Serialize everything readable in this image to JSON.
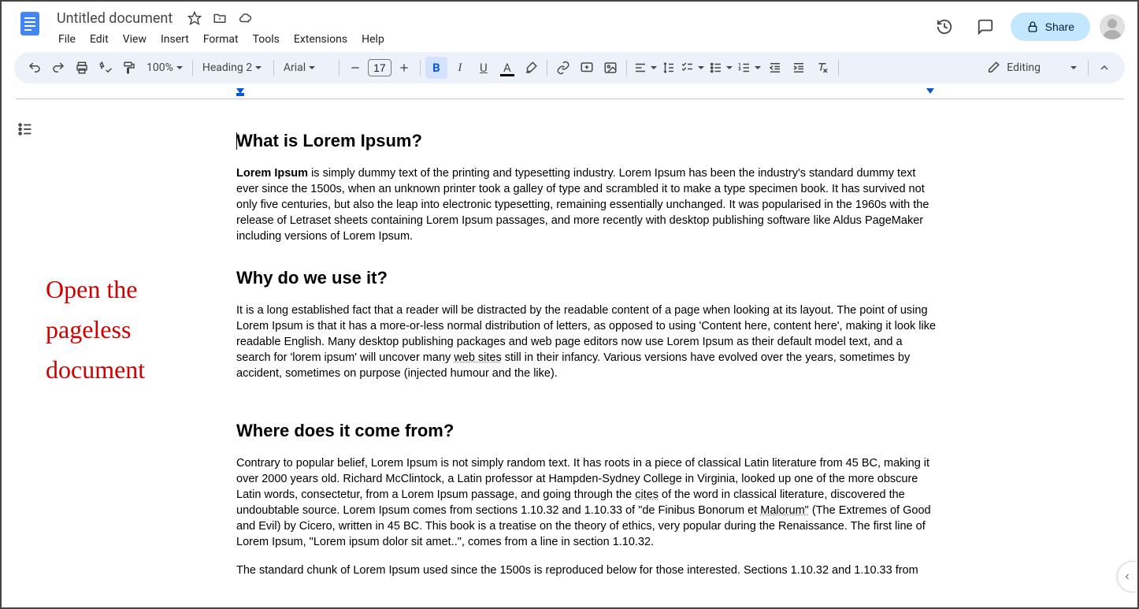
{
  "header": {
    "title": "Untitled document",
    "menus": [
      "File",
      "Edit",
      "View",
      "Insert",
      "Format",
      "Tools",
      "Extensions",
      "Help"
    ],
    "share_label": "Share"
  },
  "toolbar": {
    "zoom": "100%",
    "paragraph_style": "Heading 2",
    "font": "Arial",
    "font_size": "17",
    "editing_label": "Editing"
  },
  "document": {
    "h1": "What is Lorem Ipsum?",
    "p1_strong": "Lorem Ipsum",
    "p1": " is simply dummy text of the printing and typesetting industry. Lorem Ipsum has been the industry's standard dummy text ever since the 1500s, when an unknown printer took a galley of type and scrambled it to make a type specimen book. It has survived not only five centuries, but also the leap into electronic typesetting, remaining essentially unchanged. It was popularised in the 1960s with the release of Letraset sheets containing Lorem Ipsum passages, and more recently with desktop publishing software like Aldus PageMaker including versions of Lorem Ipsum.",
    "h2": "Why do we use it?",
    "p2a": "It is a long established fact that a reader will be distracted by the readable content of a page when looking at its layout. The point of using Lorem Ipsum is that it has a more-or-less normal distribution of letters, as opposed to using 'Content here, content here', making it look like readable English. Many desktop publishing packages and web page editors now use Lorem Ipsum as their default model text, and a search for 'lorem ipsum' will uncover many ",
    "p2_underline": "web sites",
    "p2b": " still in their infancy. Various versions have evolved over the years, sometimes by accident, sometimes on purpose (injected humour and the like).",
    "h3": "Where does it come from?",
    "p3a": "Contrary to popular belief, Lorem Ipsum is not simply random text. It has roots in a piece of classical Latin literature from 45 BC, making it over 2000 years old. Richard McClintock, a Latin professor at Hampden-Sydney College in Virginia, looked up one of the more obscure Latin words, consectetur, from a Lorem Ipsum passage, and going through the ",
    "p3_cites": "cites",
    "p3b": " of the word in classical literature, discovered the undoubtable source. Lorem Ipsum comes from sections 1.10.32 and 1.10.33 of \"de Finibus Bonorum et ",
    "p3_malorum": "Malorum\"",
    "p3c": " (The Extremes of Good and Evil) by Cicero, written in 45 BC. This book is a treatise on the theory of ethics, very popular during the Renaissance. The first line of Lorem Ipsum, \"Lorem ipsum dolor sit amet..\", comes from a line in section 1.10.32.",
    "p4": "The standard chunk of Lorem Ipsum used since the 1500s is reproduced below for those interested. Sections 1.10.32 and 1.10.33 from"
  },
  "annotation": {
    "line1": "Open the",
    "line2": "pageless",
    "line3": "document"
  }
}
